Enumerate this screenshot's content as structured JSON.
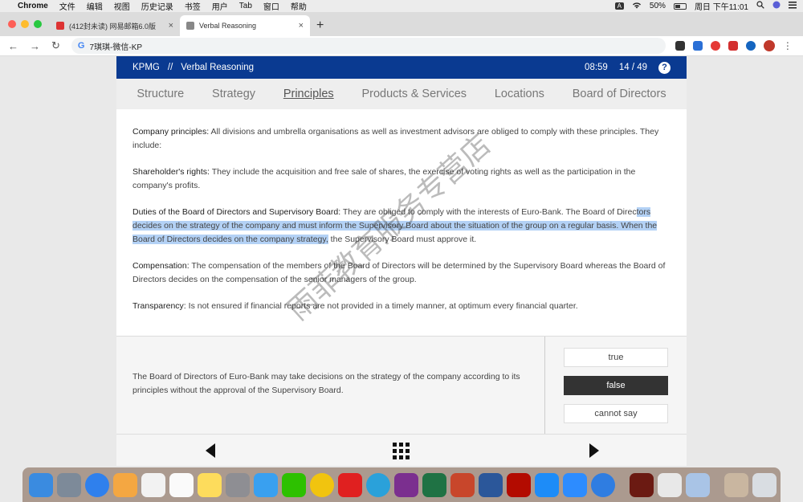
{
  "menubar": {
    "apple": "",
    "app": "Chrome",
    "items": [
      "文件",
      "编辑",
      "视图",
      "历史记录",
      "书签",
      "用户",
      "Tab",
      "窗口",
      "帮助"
    ],
    "input_badge": "A",
    "battery": "50%",
    "clock": "周日 下午11:01"
  },
  "browser": {
    "tabs": [
      {
        "title": "(412封未读) 网易邮箱6.0版",
        "close": "×"
      },
      {
        "title": "Verbal Reasoning",
        "close": "×"
      }
    ],
    "new_tab": "+",
    "back": "←",
    "forward": "→",
    "reload": "↻",
    "address_prefix": "G",
    "address": "7琪琪-微信-KP",
    "more": "⋮"
  },
  "test": {
    "brand": "KPMG",
    "separator": "//",
    "section": "Verbal Reasoning",
    "timer": "08:59",
    "progress": "14 / 49",
    "help": "?",
    "nav_tabs": [
      "Structure",
      "Strategy",
      "Principles",
      "Products & Services",
      "Locations",
      "Board of Directors"
    ],
    "active_tab": "Principles",
    "paragraphs": {
      "p1_label": "Company principles:",
      "p1_text": " All divisions and umbrella organisations as well as investment advisors are obliged to comply with these principles. They include:",
      "p2_label": "Shareholder's rights:",
      "p2_text": " They include the acquisition and free sale of shares, the exercise of voting rights as well as the participation in the company's profits.",
      "p3_label": "Duties of the Board of Directors and Supervisory Board:",
      "p3_text_a": " They are obliged to comply with the interests of Euro-Bank. The Board of Direc",
      "p3_text_hl": "tors decides on the strategy of the company and must inform the Supervisory Board about the situation of the group on a regular basis. When the Board of Directors decides on the company strategy,",
      "p3_text_b": " the Supervisory Board must approve it.",
      "p4_label": "Compensation:",
      "p4_text": " The compensation of the members of the Board of Directors will be determined by the Supervisory Board whereas the Board of Directors decides on the compensation of the senior managers of the group.",
      "p5_label": "Transparency:",
      "p5_text": " Is not ensured if financial reports are not provided in a timely manner, at optimum every financial quarter."
    },
    "question": "The Board of Directors of Euro-Bank may take decisions on the strategy of the company according to its principles without the approval of the Supervisory Board.",
    "options": [
      "true",
      "false",
      "cannot say"
    ],
    "selected_option": "false"
  },
  "watermark": "雨菲教育服务专营店",
  "colors": {
    "header_blue": "#0a3a91",
    "selected_option": "#333333",
    "highlight": "#b3d1f5"
  }
}
